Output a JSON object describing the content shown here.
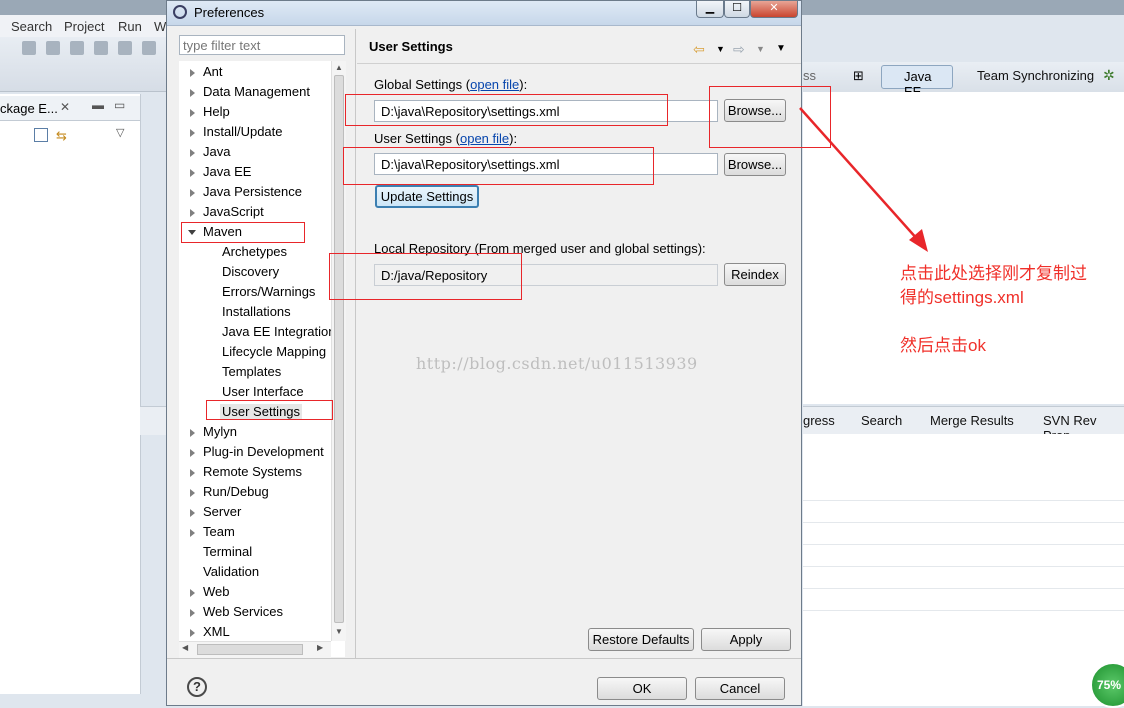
{
  "ide": {
    "menu": [
      "Search",
      "Project",
      "Run",
      "W"
    ],
    "left_tab_label": "ckage E...",
    "perspectives": {
      "partial": "ss",
      "java_ee": "Java EE",
      "team_sync": "Team Synchronizing"
    },
    "bottom_tabs": {
      "progress": "gress",
      "search": "Search",
      "merge": "Merge Results",
      "svn": "SVN Rev Prop"
    },
    "zoom_badge": "75%"
  },
  "dialog": {
    "title": "Preferences",
    "filter_placeholder": "type filter text",
    "tree": [
      {
        "label": "Ant",
        "expandable": true
      },
      {
        "label": "Data Management",
        "expandable": true
      },
      {
        "label": "Help",
        "expandable": true
      },
      {
        "label": "Install/Update",
        "expandable": true
      },
      {
        "label": "Java",
        "expandable": true
      },
      {
        "label": "Java EE",
        "expandable": true
      },
      {
        "label": "Java Persistence",
        "expandable": true
      },
      {
        "label": "JavaScript",
        "expandable": true
      },
      {
        "label": "Maven",
        "expandable": true,
        "expanded": true
      },
      {
        "label": "Archetypes",
        "child": true
      },
      {
        "label": "Discovery",
        "child": true
      },
      {
        "label": "Errors/Warnings",
        "child": true
      },
      {
        "label": "Installations",
        "child": true
      },
      {
        "label": "Java EE Integration",
        "child": true
      },
      {
        "label": "Lifecycle Mapping",
        "child": true
      },
      {
        "label": "Templates",
        "child": true
      },
      {
        "label": "User Interface",
        "child": true
      },
      {
        "label": "User Settings",
        "child": true,
        "selected": true
      },
      {
        "label": "Mylyn",
        "expandable": true
      },
      {
        "label": "Plug-in Development",
        "expandable": true
      },
      {
        "label": "Remote Systems",
        "expandable": true
      },
      {
        "label": "Run/Debug",
        "expandable": true
      },
      {
        "label": "Server",
        "expandable": true
      },
      {
        "label": "Team",
        "expandable": true
      },
      {
        "label": "Terminal",
        "expandable": false
      },
      {
        "label": "Validation",
        "expandable": false
      },
      {
        "label": "Web",
        "expandable": true
      },
      {
        "label": "Web Services",
        "expandable": true
      },
      {
        "label": "XML",
        "expandable": true
      }
    ],
    "page": {
      "title": "User Settings",
      "global_label": "Global Settings (",
      "global_link": "open file",
      "global_suffix": "):",
      "global_value": "D:\\java\\Repository\\settings.xml",
      "user_label": "User Settings (",
      "user_link": "open file",
      "user_suffix": "):",
      "user_value": "D:\\java\\Repository\\settings.xml",
      "browse_label": "Browse...",
      "update_label": "Update Settings",
      "local_label": "Local Repository (From merged user and global settings):",
      "local_value": "D:/java/Repository",
      "reindex_label": "Reindex",
      "restore_label": "Restore Defaults",
      "apply_label": "Apply"
    },
    "ok_label": "OK",
    "cancel_label": "Cancel",
    "help_glyph": "?"
  },
  "annotation": {
    "line1": "点击此处选择刚才复制过",
    "line2": "得的settings.xml",
    "line3": "然后点击ok",
    "watermark": "http://blog.csdn.net/u011513939",
    "color": "#f0302a"
  }
}
